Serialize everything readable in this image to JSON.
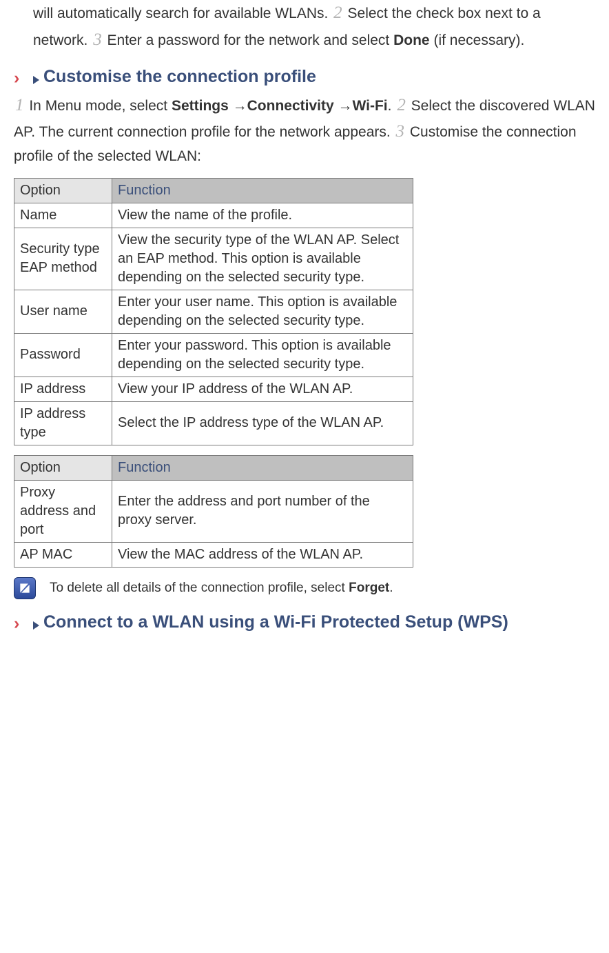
{
  "intro": {
    "p1_a": "will automatically search for available WLANs. ",
    "s2": "2",
    "p1_b": " Select the check box next to a network. ",
    "s3": "3",
    "p1_c": " Enter a password for the network and select ",
    "done": "Done",
    "p1_d": " (if necessary)."
  },
  "h1": "Customise the connection profile",
  "custom": {
    "s1": "1",
    "a": " In Menu mode, select ",
    "settings": "Settings",
    "arrow1": " →",
    "connectivity": "Connectivity",
    "arrow2": " →",
    "wifi": "Wi-Fi",
    "dot": ". ",
    "s2": "2",
    "b": " Select the discovered WLAN AP. The current connection profile for the network appears. ",
    "s3": "3",
    "c": " Customise the connection profile of the selected WLAN:"
  },
  "table1": {
    "head_opt": "Option",
    "head_func": "Function",
    "rows": [
      {
        "opt": "Name",
        "func": "View the name of the profile."
      },
      {
        "opt": "Security type EAP method",
        "func": "View the security type of the WLAN AP. Select an EAP method. This option is available depending on the selected security type."
      },
      {
        "opt": "User name",
        "func": "Enter your user name. This option is available depending on the selected security type."
      },
      {
        "opt": "Password",
        "func": "Enter your password. This option is available depending on the selected security type."
      },
      {
        "opt": "IP address",
        "func": "View your IP address of the WLAN AP."
      },
      {
        "opt": "IP address type",
        "func": "Select the IP address type of the WLAN AP."
      }
    ]
  },
  "table2": {
    "head_opt": "Option",
    "head_func": "Function",
    "rows": [
      {
        "opt": "Proxy address and port",
        "func": "Enter the address and port number of the proxy server."
      },
      {
        "opt": "AP MAC",
        "func": "View the MAC address of the WLAN AP."
      }
    ]
  },
  "note": {
    "a": "To delete all details of the connection profile, select ",
    "forget": "Forget",
    "b": "."
  },
  "h2": "Connect to a WLAN using a Wi-Fi Protected Setup (WPS)"
}
